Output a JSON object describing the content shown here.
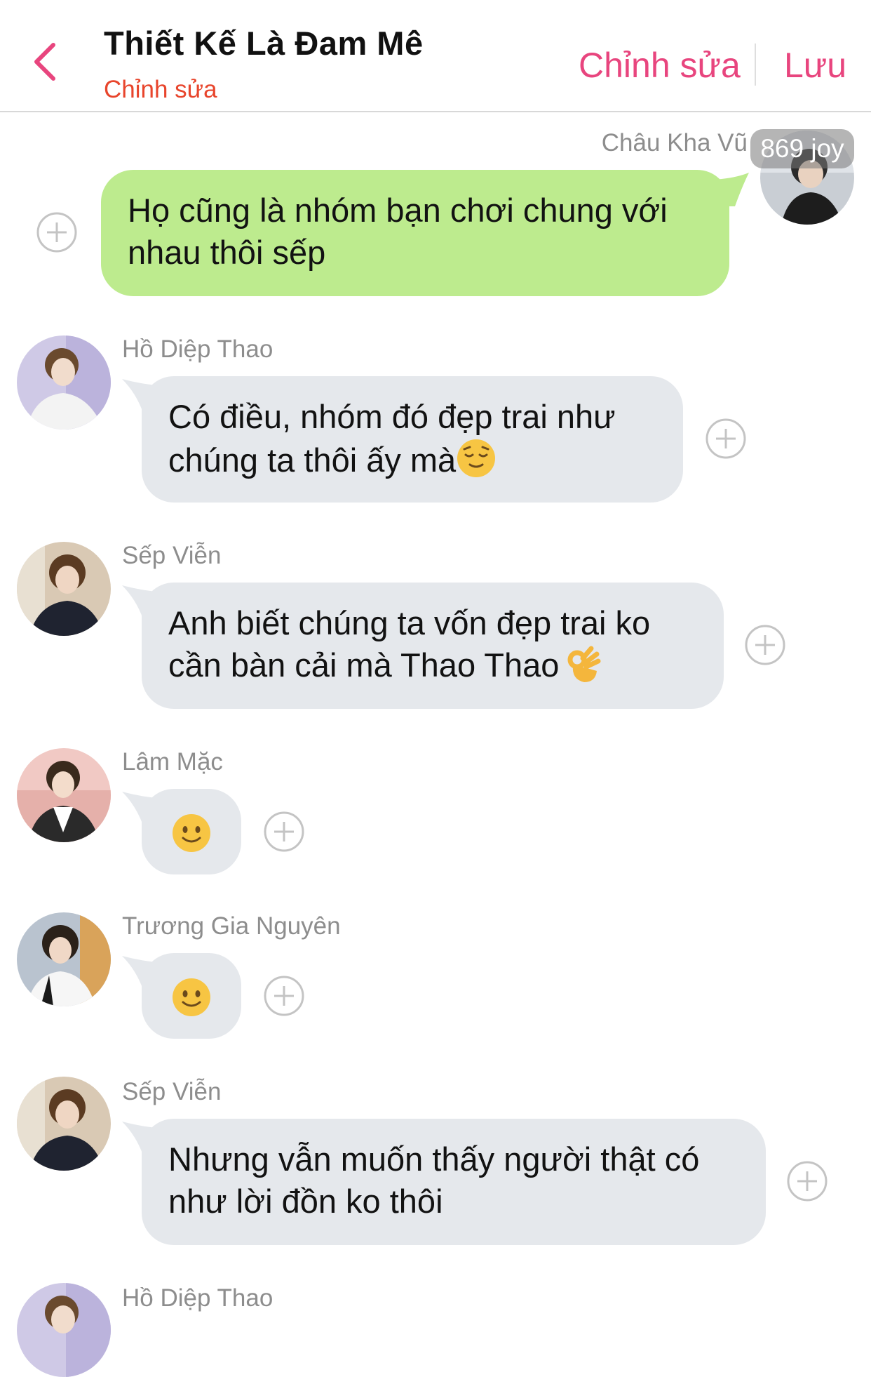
{
  "header": {
    "title": "Thiết Kế Là Đam Mê",
    "subtitle": "Chỉnh sửa",
    "edit_label": "Chỉnh sửa",
    "save_label": "Lưu",
    "accent_color": "#e8457e"
  },
  "watermark": "869 joy",
  "messages": [
    {
      "sender": "Châu Kha Vũ",
      "direction": "sent",
      "text_line1": "Họ cũng là nhóm bạn chơi chung với",
      "text_line2": "nhau thôi sếp"
    },
    {
      "sender": "Hồ Diệp Thao",
      "direction": "received",
      "text_line1": "Có điều, nhóm đó đẹp trai như",
      "text_line2": "chúng ta thôi ấy mà",
      "emoji": "relieved-face"
    },
    {
      "sender": "Sếp Viễn",
      "direction": "received",
      "text_line1": "Anh biết chúng ta vốn đẹp trai ko",
      "text_line2": "cần bàn cải mà Thao Thao",
      "emoji": "ok-hand"
    },
    {
      "sender": "Lâm Mặc",
      "direction": "received",
      "emoji": "slightly-smiling-face"
    },
    {
      "sender": "Trương Gia Nguyên",
      "direction": "received",
      "emoji": "slightly-smiling-face"
    },
    {
      "sender": "Sếp Viễn",
      "direction": "received",
      "text_line1": "Nhưng vẫn muốn thấy người thật có",
      "text_line2": "như lời đồn ko thôi"
    },
    {
      "sender": "Hồ Diệp Thao",
      "direction": "received"
    }
  ],
  "colors": {
    "sent_bubble": "#bdeb8e",
    "received_bubble": "#e5e8ec",
    "name_gray": "#8d8d8d"
  }
}
